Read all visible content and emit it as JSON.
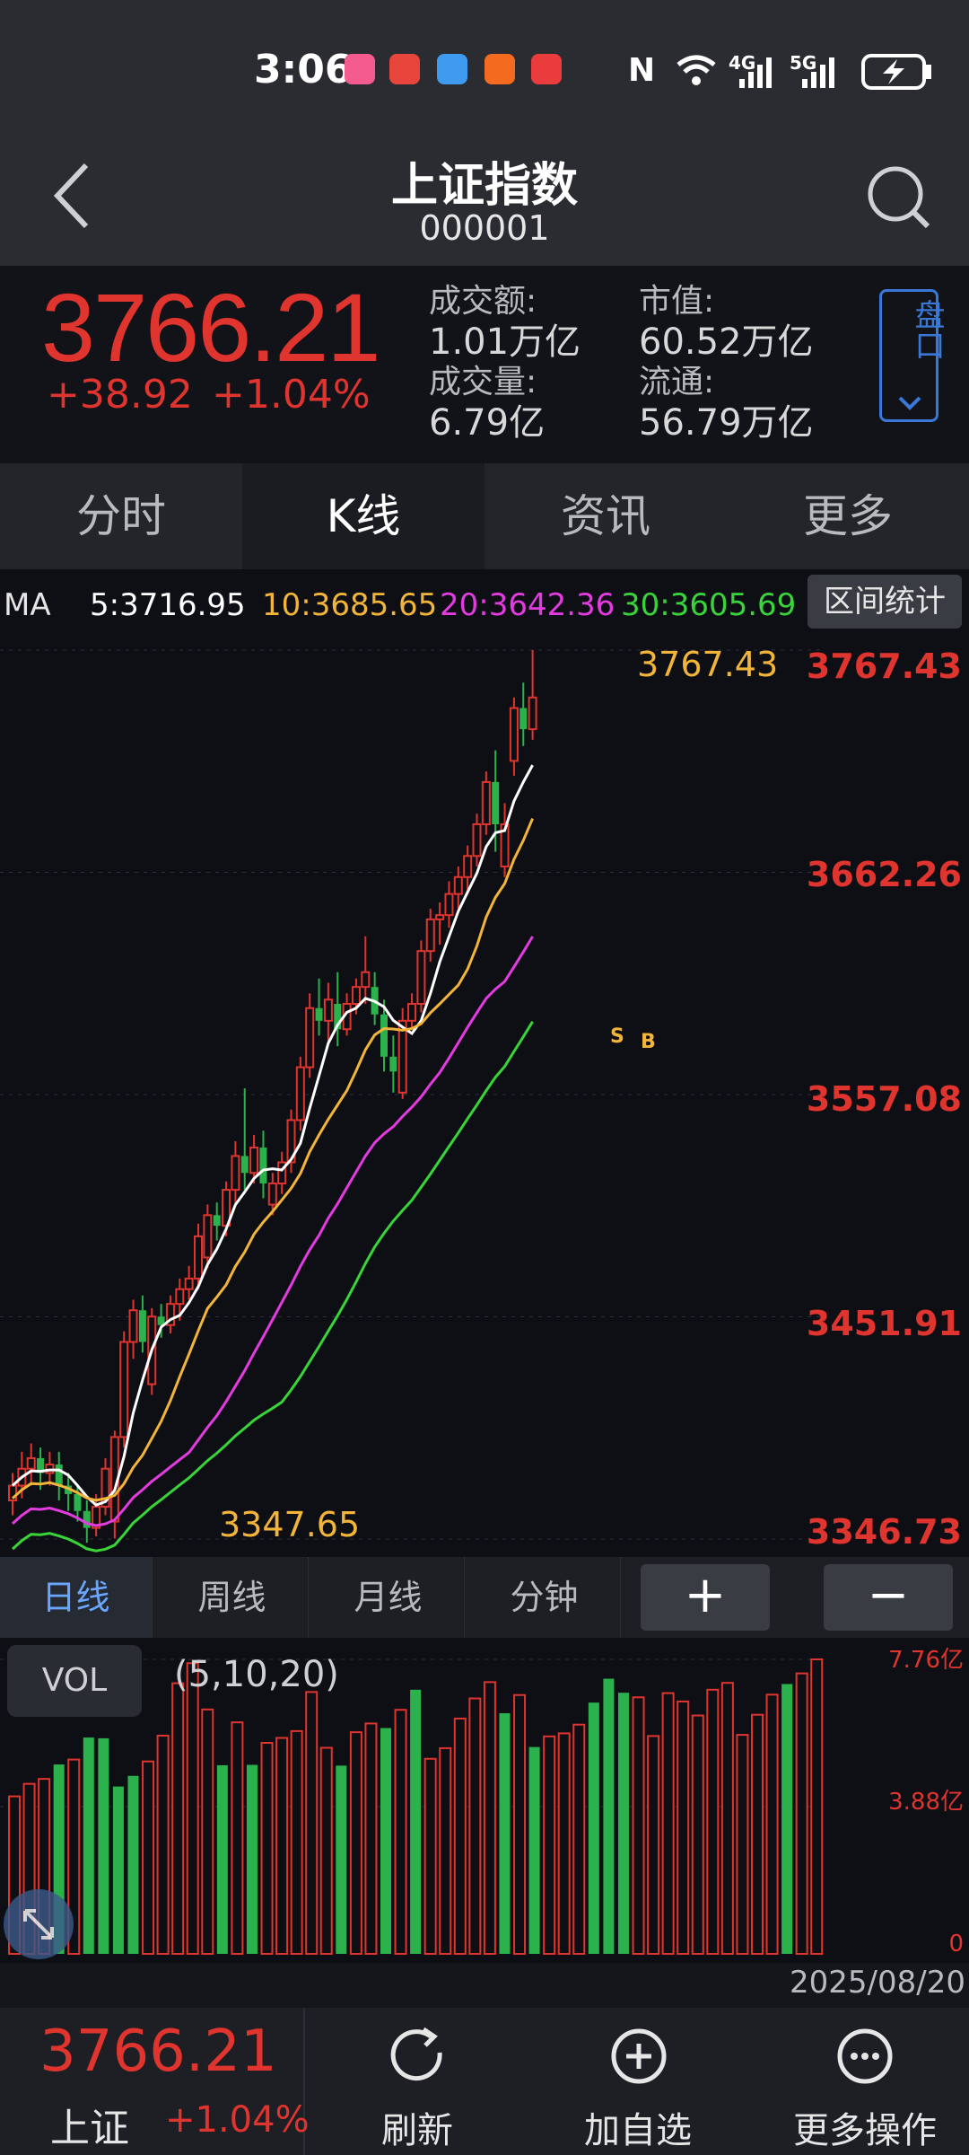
{
  "status": {
    "time": "3:06",
    "net1": "4G",
    "net2": "5G"
  },
  "title": {
    "name": "上证指数",
    "code": "000001"
  },
  "quote": {
    "price": "3766.21",
    "change": "+38.92",
    "change_pct": "+1.04%",
    "turnover_label": "成交额:",
    "turnover": "1.01万亿",
    "volume_label": "成交量:",
    "volume": "6.79亿",
    "mktcap_label": "市值:",
    "mktcap": "60.52万亿",
    "float_label": "流通:",
    "float": "56.79万亿",
    "pankou": "盘口"
  },
  "tabs": [
    "分时",
    "K线",
    "资讯",
    "更多"
  ],
  "ma": {
    "label": "MA",
    "ma5": "5:3716.95",
    "ma10": "10:3685.65",
    "ma20": "20:3642.36",
    "ma30": "30:3605.69",
    "range_stat": "区间统计"
  },
  "colors": {
    "up": "#e0342f",
    "down": "#2bb24c",
    "ma5": "#ffffff",
    "ma10": "#f2b53a",
    "ma20": "#e43be0",
    "ma30": "#38d43a"
  },
  "yaxis": [
    "3767.43",
    "3662.26",
    "3557.08",
    "3451.91",
    "3346.73"
  ],
  "annotations": {
    "high": "3767.43",
    "low": "3347.65",
    "s_mark": "S",
    "b_mark": "B"
  },
  "period_tabs": [
    "日线",
    "周线",
    "月线",
    "分钟"
  ],
  "zoom": {
    "plus": "+",
    "minus": "−"
  },
  "vol": {
    "label": "VOL",
    "params": "(5,10,20)",
    "max": "7.76亿",
    "mid": "3.88亿",
    "zero": "0"
  },
  "date": "2025/08/20",
  "bottom": {
    "price": "3766.21",
    "name": "上证",
    "pct": "+1.04%",
    "refresh": "刷新",
    "add": "加自选",
    "more": "更多操作"
  },
  "chart_data": {
    "type": "candlestick",
    "ylim": [
      3346.73,
      3767.43
    ],
    "candles": [
      [
        3365,
        3372,
        3358,
        3378,
        1
      ],
      [
        3372,
        3380,
        3366,
        3388,
        1
      ],
      [
        3380,
        3385,
        3372,
        3392,
        1
      ],
      [
        3385,
        3378,
        3370,
        3390,
        0
      ],
      [
        3378,
        3382,
        3372,
        3388,
        1
      ],
      [
        3382,
        3372,
        3365,
        3388,
        0
      ],
      [
        3372,
        3368,
        3360,
        3378,
        0
      ],
      [
        3368,
        3360,
        3355,
        3372,
        0
      ],
      [
        3360,
        3352,
        3345,
        3365,
        0
      ],
      [
        3352,
        3362,
        3348,
        3368,
        1
      ],
      [
        3362,
        3380,
        3358,
        3385,
        1
      ],
      [
        3355,
        3395,
        3347,
        3398,
        1
      ],
      [
        3395,
        3440,
        3390,
        3445,
        1
      ],
      [
        3440,
        3455,
        3432,
        3460,
        1
      ],
      [
        3455,
        3440,
        3435,
        3462,
        0
      ],
      [
        3420,
        3452,
        3415,
        3456,
        1
      ],
      [
        3452,
        3448,
        3442,
        3458,
        0
      ],
      [
        3448,
        3458,
        3444,
        3462,
        1
      ],
      [
        3458,
        3465,
        3450,
        3470,
        1
      ],
      [
        3465,
        3470,
        3460,
        3476,
        1
      ],
      [
        3470,
        3490,
        3465,
        3496,
        1
      ],
      [
        3480,
        3500,
        3475,
        3505,
        1
      ],
      [
        3500,
        3495,
        3488,
        3506,
        0
      ],
      [
        3495,
        3512,
        3490,
        3516,
        1
      ],
      [
        3512,
        3528,
        3505,
        3535,
        1
      ],
      [
        3528,
        3520,
        3512,
        3560,
        0
      ],
      [
        3520,
        3532,
        3515,
        3538,
        1
      ],
      [
        3532,
        3515,
        3508,
        3540,
        0
      ],
      [
        3505,
        3515,
        3500,
        3520,
        1
      ],
      [
        3515,
        3525,
        3510,
        3530,
        1
      ],
      [
        3525,
        3545,
        3520,
        3550,
        1
      ],
      [
        3545,
        3570,
        3540,
        3575,
        1
      ],
      [
        3570,
        3598,
        3565,
        3605,
        1
      ],
      [
        3598,
        3592,
        3585,
        3612,
        0
      ],
      [
        3592,
        3602,
        3582,
        3610,
        1
      ],
      [
        3600,
        3588,
        3580,
        3615,
        0
      ],
      [
        3588,
        3600,
        3585,
        3605,
        1
      ],
      [
        3600,
        3608,
        3595,
        3612,
        1
      ],
      [
        3608,
        3615,
        3600,
        3632,
        1
      ],
      [
        3608,
        3595,
        3590,
        3615,
        0
      ],
      [
        3595,
        3575,
        3568,
        3602,
        0
      ],
      [
        3575,
        3568,
        3558,
        3585,
        0
      ],
      [
        3558,
        3592,
        3555,
        3598,
        1
      ],
      [
        3592,
        3600,
        3588,
        3605,
        1
      ],
      [
        3600,
        3625,
        3596,
        3630,
        1
      ],
      [
        3625,
        3640,
        3620,
        3645,
        1
      ],
      [
        3640,
        3642,
        3628,
        3648,
        1
      ],
      [
        3642,
        3652,
        3636,
        3658,
        1
      ],
      [
        3652,
        3660,
        3645,
        3665,
        1
      ],
      [
        3660,
        3670,
        3652,
        3675,
        1
      ],
      [
        3670,
        3685,
        3665,
        3690,
        1
      ],
      [
        3685,
        3705,
        3680,
        3710,
        1
      ],
      [
        3705,
        3685,
        3672,
        3720,
        0
      ],
      [
        3685,
        3665,
        3660,
        3695,
        1
      ],
      [
        3715,
        3740,
        3708,
        3745,
        1
      ],
      [
        3740,
        3730,
        3722,
        3752,
        0
      ],
      [
        3730,
        3745,
        3725,
        3767.43,
        1
      ]
    ],
    "ma_labels": {
      "ma5": "3716.95",
      "ma10": "3685.65",
      "ma20": "3642.36",
      "ma30": "3605.69"
    },
    "volume_max": 7.76
  }
}
